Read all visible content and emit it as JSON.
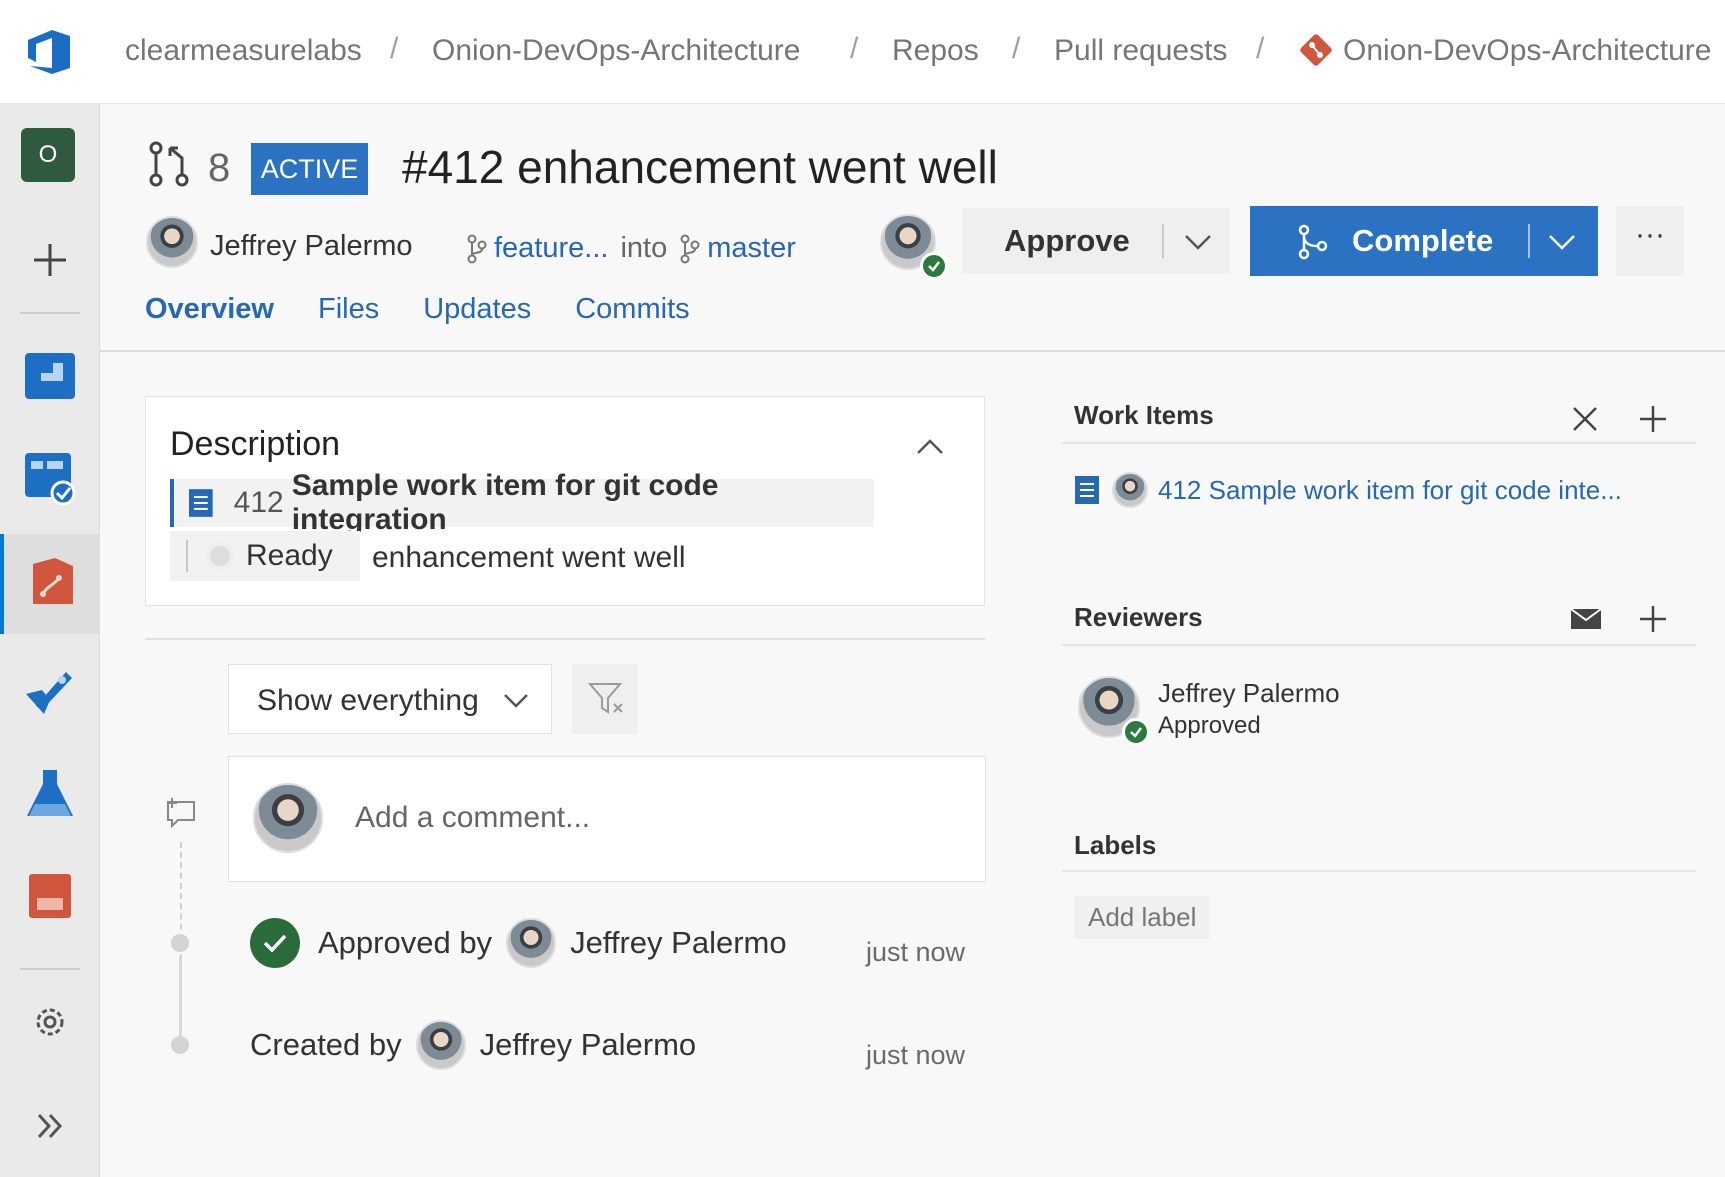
{
  "breadcrumb": {
    "org": "clearmeasurelabs",
    "project": "Onion-DevOps-Architecture",
    "section": "Repos",
    "page": "Pull requests",
    "repo": "Onion-DevOps-Architecture",
    "separator": "/"
  },
  "nav": {
    "org_initial": "O",
    "items": [
      "overview-icon",
      "boards-icon",
      "repos-icon",
      "pipelines-icon",
      "test-plans-icon",
      "artifacts-icon",
      "settings-icon",
      "expand-icon"
    ]
  },
  "pr": {
    "id": "8",
    "status": "ACTIVE",
    "title": "#412 enhancement went well",
    "author": "Jeffrey Palermo",
    "source_branch": "feature...",
    "into_text": "into",
    "target_branch": "master"
  },
  "actions": {
    "approve_label": "Approve",
    "complete_label": "Complete",
    "more_label": "···"
  },
  "tabs": [
    "Overview",
    "Files",
    "Updates",
    "Commits"
  ],
  "description": {
    "title": "Description",
    "work_item_number": "412",
    "work_item_title": "Sample work item for git code integration",
    "state_label": "Ready",
    "text": "enhancement went well"
  },
  "filter": {
    "selected": "Show everything"
  },
  "comment": {
    "placeholder": "Add a comment..."
  },
  "activity": [
    {
      "prefix": "Approved by",
      "user": "Jeffrey Palermo",
      "time": "just now"
    },
    {
      "prefix": "Created by",
      "user": "Jeffrey Palermo",
      "time": "just now"
    }
  ],
  "side": {
    "work_items_title": "Work Items",
    "work_item_link": "412 Sample work item for git code inte...",
    "reviewers_title": "Reviewers",
    "reviewer_name": "Jeffrey Palermo",
    "reviewer_status": "Approved",
    "labels_title": "Labels",
    "add_label": "Add label"
  },
  "colors": {
    "accent": "#2b73c2",
    "link": "#2668b3",
    "approved": "#2a7a3f",
    "repo_icon": "#d0573d"
  }
}
